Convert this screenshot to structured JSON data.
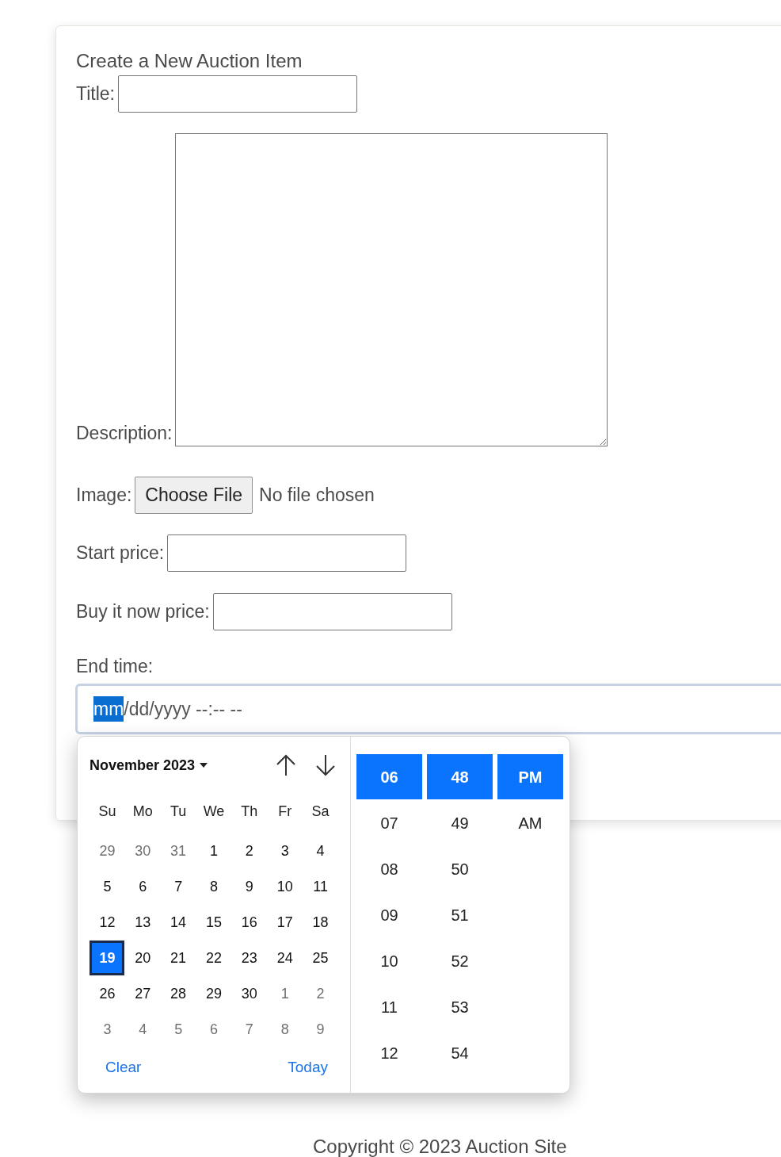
{
  "heading": "Create a New Auction Item",
  "title_field": {
    "label": "Title:"
  },
  "description_field": {
    "label": "Description:"
  },
  "image_field": {
    "label": "Image:",
    "button": "Choose File",
    "status": "No file chosen"
  },
  "start_price_field": {
    "label": "Start price:"
  },
  "buy_now_field": {
    "label": "Buy it now price:"
  },
  "end_time_field": {
    "label": "End time:",
    "segments": [
      {
        "text": "mm",
        "selected": true
      },
      {
        "text": "/dd/yyyy --:-- --",
        "selected": false
      }
    ]
  },
  "picker": {
    "month": "November 2023",
    "weekdays": [
      "Su",
      "Mo",
      "Tu",
      "We",
      "Th",
      "Fr",
      "Sa"
    ],
    "weeks": [
      [
        {
          "text": "29",
          "other_month": true,
          "selected": false
        },
        {
          "text": "30",
          "other_month": true,
          "selected": false
        },
        {
          "text": "31",
          "other_month": true,
          "selected": false
        },
        {
          "text": "1",
          "other_month": false,
          "selected": false
        },
        {
          "text": "2",
          "other_month": false,
          "selected": false
        },
        {
          "text": "3",
          "other_month": false,
          "selected": false
        },
        {
          "text": "4",
          "other_month": false,
          "selected": false
        }
      ],
      [
        {
          "text": "5",
          "other_month": false,
          "selected": false
        },
        {
          "text": "6",
          "other_month": false,
          "selected": false
        },
        {
          "text": "7",
          "other_month": false,
          "selected": false
        },
        {
          "text": "8",
          "other_month": false,
          "selected": false
        },
        {
          "text": "9",
          "other_month": false,
          "selected": false
        },
        {
          "text": "10",
          "other_month": false,
          "selected": false
        },
        {
          "text": "11",
          "other_month": false,
          "selected": false
        }
      ],
      [
        {
          "text": "12",
          "other_month": false,
          "selected": false
        },
        {
          "text": "13",
          "other_month": false,
          "selected": false
        },
        {
          "text": "14",
          "other_month": false,
          "selected": false
        },
        {
          "text": "15",
          "other_month": false,
          "selected": false
        },
        {
          "text": "16",
          "other_month": false,
          "selected": false
        },
        {
          "text": "17",
          "other_month": false,
          "selected": false
        },
        {
          "text": "18",
          "other_month": false,
          "selected": false
        }
      ],
      [
        {
          "text": "19",
          "other_month": false,
          "selected": true
        },
        {
          "text": "20",
          "other_month": false,
          "selected": false
        },
        {
          "text": "21",
          "other_month": false,
          "selected": false
        },
        {
          "text": "22",
          "other_month": false,
          "selected": false
        },
        {
          "text": "23",
          "other_month": false,
          "selected": false
        },
        {
          "text": "24",
          "other_month": false,
          "selected": false
        },
        {
          "text": "25",
          "other_month": false,
          "selected": false
        }
      ],
      [
        {
          "text": "26",
          "other_month": false,
          "selected": false
        },
        {
          "text": "27",
          "other_month": false,
          "selected": false
        },
        {
          "text": "28",
          "other_month": false,
          "selected": false
        },
        {
          "text": "29",
          "other_month": false,
          "selected": false
        },
        {
          "text": "30",
          "other_month": false,
          "selected": false
        },
        {
          "text": "1",
          "other_month": true,
          "selected": false
        },
        {
          "text": "2",
          "other_month": true,
          "selected": false
        }
      ],
      [
        {
          "text": "3",
          "other_month": true,
          "selected": false
        },
        {
          "text": "4",
          "other_month": true,
          "selected": false
        },
        {
          "text": "5",
          "other_month": true,
          "selected": false
        },
        {
          "text": "6",
          "other_month": true,
          "selected": false
        },
        {
          "text": "7",
          "other_month": true,
          "selected": false
        },
        {
          "text": "8",
          "other_month": true,
          "selected": false
        },
        {
          "text": "9",
          "other_month": true,
          "selected": false
        }
      ]
    ],
    "clear": "Clear",
    "today": "Today",
    "hours": [
      {
        "text": "06",
        "selected": true
      },
      {
        "text": "07",
        "selected": false
      },
      {
        "text": "08",
        "selected": false
      },
      {
        "text": "09",
        "selected": false
      },
      {
        "text": "10",
        "selected": false
      },
      {
        "text": "11",
        "selected": false
      },
      {
        "text": "12",
        "selected": false
      }
    ],
    "minutes": [
      {
        "text": "48",
        "selected": true
      },
      {
        "text": "49",
        "selected": false
      },
      {
        "text": "50",
        "selected": false
      },
      {
        "text": "51",
        "selected": false
      },
      {
        "text": "52",
        "selected": false
      },
      {
        "text": "53",
        "selected": false
      },
      {
        "text": "54",
        "selected": false
      }
    ],
    "periods": [
      {
        "text": "PM",
        "selected": true
      },
      {
        "text": "AM",
        "selected": false
      }
    ]
  },
  "footer": "Copyright © 2023 Auction Site"
}
